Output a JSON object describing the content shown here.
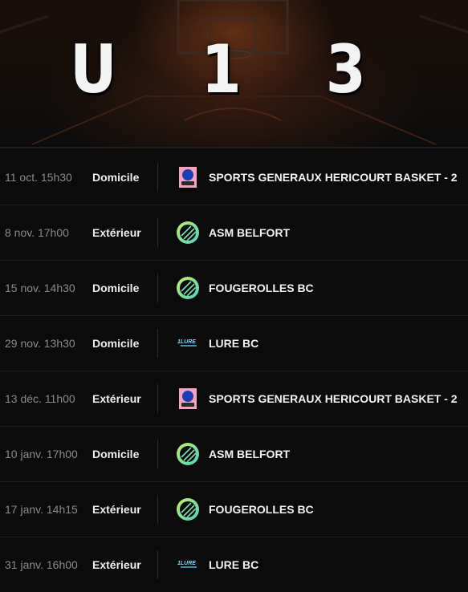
{
  "header": {
    "title": "U 1 3"
  },
  "matches": [
    {
      "date": "11 oct. 15h30",
      "venue": "Domicile",
      "team": "SPORTS GENERAUX HERICOURT BASKET - 2",
      "logo": "hericourt-logo-icon"
    },
    {
      "date": "8 nov. 17h00",
      "venue": "Extérieur",
      "team": "ASM BELFORT",
      "logo": "basketball-logo-icon"
    },
    {
      "date": "15 nov. 14h30",
      "venue": "Domicile",
      "team": "FOUGEROLLES BC",
      "logo": "basketball-logo-icon"
    },
    {
      "date": "29 nov. 13h30",
      "venue": "Domicile",
      "team": "LURE BC",
      "logo": "lure-logo-icon"
    },
    {
      "date": "13 déc. 11h00",
      "venue": "Extérieur",
      "team": "SPORTS GENERAUX HERICOURT BASKET - 2",
      "logo": "hericourt-logo-icon"
    },
    {
      "date": "10 janv. 17h00",
      "venue": "Domicile",
      "team": "ASM BELFORT",
      "logo": "basketball-logo-icon"
    },
    {
      "date": "17 janv. 14h15",
      "venue": "Extérieur",
      "team": "FOUGEROLLES BC",
      "logo": "basketball-logo-icon"
    },
    {
      "date": "31 janv. 16h00",
      "venue": "Extérieur",
      "team": "LURE BC",
      "logo": "lure-logo-icon"
    }
  ]
}
